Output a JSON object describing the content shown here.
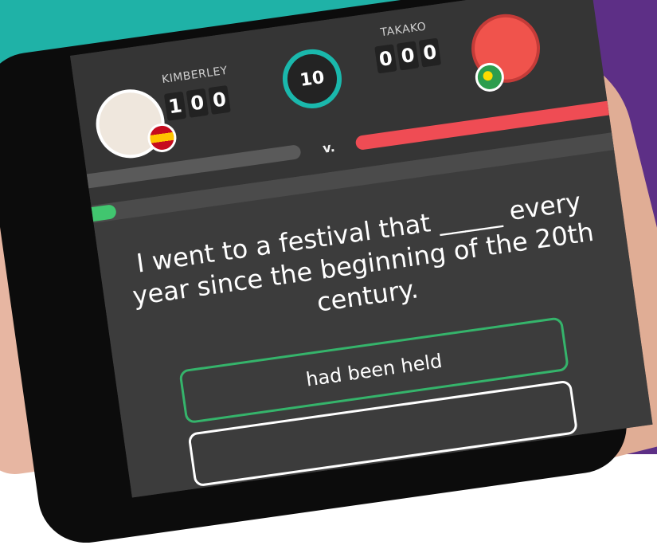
{
  "players": {
    "left": {
      "name": "KIMBERLEY",
      "score_digits": [
        "1",
        "0",
        "0"
      ],
      "flag": "spain-flag-icon"
    },
    "right": {
      "name": "TAKAKO",
      "score_digits": [
        "0",
        "0",
        "0"
      ],
      "flag": "brazil-flag-icon"
    }
  },
  "timer": {
    "seconds": "10"
  },
  "vs_label": "v.",
  "progress": {
    "right_health_fraction": 1.0,
    "left_health_fraction": 0.0,
    "question_progress_fraction": 0.06
  },
  "question": {
    "text": "I went to a festival that _____ every year since the beginning of the 20th century."
  },
  "answers": [
    {
      "label": "had been held"
    },
    {
      "label": ""
    }
  ],
  "colors": {
    "teal_bg": "#1fb2a7",
    "purple_bg": "#5d2f86",
    "timer_ring": "#1ab8ac",
    "right_bar": "#ef4c54",
    "progress_green": "#41c66f"
  }
}
